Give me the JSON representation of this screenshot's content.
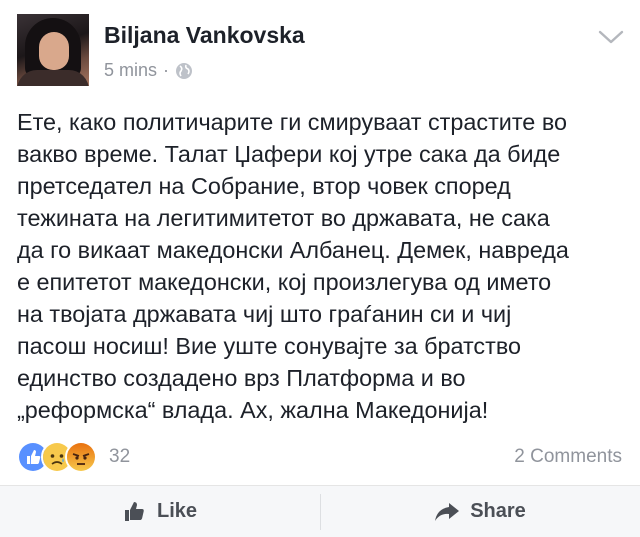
{
  "post": {
    "author": "Biljana Vankovska",
    "time": "5 mins",
    "separator": "·",
    "privacy_icon": "globe-icon",
    "text_lines": [
      "Ете, како политичарите ги смируваат страстите во",
      "вакво време. Талат Џафери кој утре сака да биде",
      "претседател на Собрание, втор човек според",
      "тежината на легитимитетот во државата, не сака",
      "да го викаат македонски Албанец. Демек, навреда",
      "е епитетот македонски, кој произлегува од името",
      "на твојата државата чиј што граѓанин си и чиј",
      "пасош носиш! Вие уште сонувајте за братство",
      "единство создадено врз Платформа и во",
      "„реформска“ влада. Ах, жална Македонија!"
    ]
  },
  "reactions": {
    "icons": [
      "like-icon",
      "sad-icon",
      "angry-icon"
    ],
    "count": "32",
    "comments": "2 Comments"
  },
  "actions": {
    "like_label": "Like",
    "share_label": "Share"
  },
  "colors": {
    "text": "#1d2129",
    "muted": "#90949c",
    "like_blue": "#5890ff",
    "sad_yellow": "#f7c94c",
    "angry_red": "#e9710f"
  }
}
